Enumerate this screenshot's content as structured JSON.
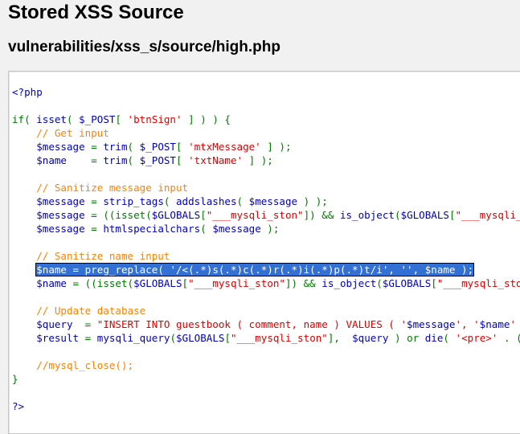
{
  "page": {
    "title": "Stored XSS Source",
    "file_path": "vulnerabilities/xss_s/source/high.php"
  },
  "colors": {
    "keyword": "#007700",
    "variable": "#0000bb",
    "string": "#dd0000",
    "comment": "#ff8000",
    "selection": "#3370d4"
  },
  "code": {
    "selected_line": 13,
    "lines": [
      [
        [
          "var",
          "<?php"
        ]
      ],
      [],
      [
        [
          "keyword",
          "if( "
        ],
        [
          "var",
          "isset"
        ],
        [
          "keyword",
          "( "
        ],
        [
          "var",
          "$_POST"
        ],
        [
          "keyword",
          "[ "
        ],
        [
          "string",
          "'btnSign'"
        ],
        [
          "keyword",
          " ] ) ) {"
        ]
      ],
      [
        [
          "plain",
          "    "
        ],
        [
          "comment",
          "// Get input"
        ]
      ],
      [
        [
          "plain",
          "    "
        ],
        [
          "var",
          "$message"
        ],
        [
          "keyword",
          " = "
        ],
        [
          "var",
          "trim"
        ],
        [
          "keyword",
          "( "
        ],
        [
          "var",
          "$_POST"
        ],
        [
          "keyword",
          "[ "
        ],
        [
          "string",
          "'mtxMessage'"
        ],
        [
          "keyword",
          " ] );"
        ]
      ],
      [
        [
          "plain",
          "    "
        ],
        [
          "var",
          "$name"
        ],
        [
          "keyword",
          "    = "
        ],
        [
          "var",
          "trim"
        ],
        [
          "keyword",
          "( "
        ],
        [
          "var",
          "$_POST"
        ],
        [
          "keyword",
          "[ "
        ],
        [
          "string",
          "'txtName'"
        ],
        [
          "keyword",
          " ] );"
        ]
      ],
      [],
      [
        [
          "plain",
          "    "
        ],
        [
          "comment",
          "// Sanitize message input"
        ]
      ],
      [
        [
          "plain",
          "    "
        ],
        [
          "var",
          "$message"
        ],
        [
          "keyword",
          " = "
        ],
        [
          "var",
          "strip_tags"
        ],
        [
          "keyword",
          "( "
        ],
        [
          "var",
          "addslashes"
        ],
        [
          "keyword",
          "( "
        ],
        [
          "var",
          "$message"
        ],
        [
          "keyword",
          " ) );"
        ]
      ],
      [
        [
          "plain",
          "    "
        ],
        [
          "var",
          "$message"
        ],
        [
          "keyword",
          " = ((isset("
        ],
        [
          "var",
          "$GLOBALS"
        ],
        [
          "keyword",
          "["
        ],
        [
          "string",
          "\"___mysqli_ston\""
        ],
        [
          "keyword",
          "]) && "
        ],
        [
          "var",
          "is_object"
        ],
        [
          "keyword",
          "("
        ],
        [
          "var",
          "$GLOBALS"
        ],
        [
          "keyword",
          "["
        ],
        [
          "string",
          "\"___mysqli_ston\""
        ],
        [
          "keyword",
          "])) ?"
        ]
      ],
      [
        [
          "plain",
          "    "
        ],
        [
          "var",
          "$message"
        ],
        [
          "keyword",
          " = "
        ],
        [
          "var",
          "htmlspecialchars"
        ],
        [
          "keyword",
          "( "
        ],
        [
          "var",
          "$message"
        ],
        [
          "keyword",
          " );"
        ]
      ],
      [],
      [
        [
          "plain",
          "    "
        ],
        [
          "comment",
          "// Sanitize name input"
        ]
      ],
      [
        [
          "plain",
          "    "
        ],
        [
          "var",
          "$name"
        ],
        [
          "keyword",
          " = "
        ],
        [
          "var",
          "preg_replace"
        ],
        [
          "keyword",
          "( "
        ],
        [
          "string",
          "'/<(.*)s(.*)c(.*)r(.*)i(.*)p(.*)t/i'"
        ],
        [
          "keyword",
          ", "
        ],
        [
          "string",
          "''"
        ],
        [
          "keyword",
          ", "
        ],
        [
          "var",
          "$name"
        ],
        [
          "keyword",
          " );"
        ]
      ],
      [
        [
          "plain",
          "    "
        ],
        [
          "var",
          "$name"
        ],
        [
          "keyword",
          " = ((isset("
        ],
        [
          "var",
          "$GLOBALS"
        ],
        [
          "keyword",
          "["
        ],
        [
          "string",
          "\"___mysqli_ston\""
        ],
        [
          "keyword",
          "]) && "
        ],
        [
          "var",
          "is_object"
        ],
        [
          "keyword",
          "("
        ],
        [
          "var",
          "$GLOBALS"
        ],
        [
          "keyword",
          "["
        ],
        [
          "string",
          "\"___mysqli_ston\""
        ],
        [
          "keyword",
          "])) ?"
        ]
      ],
      [],
      [
        [
          "plain",
          "    "
        ],
        [
          "comment",
          "// Update database"
        ]
      ],
      [
        [
          "plain",
          "    "
        ],
        [
          "var",
          "$query"
        ],
        [
          "keyword",
          "  = "
        ],
        [
          "string",
          "\"INSERT INTO guestbook ( comment, name ) VALUES ( '"
        ],
        [
          "var",
          "$message"
        ],
        [
          "string",
          "', '"
        ],
        [
          "var",
          "$name"
        ],
        [
          "string",
          "' );\""
        ],
        [
          "keyword",
          ";"
        ]
      ],
      [
        [
          "plain",
          "    "
        ],
        [
          "var",
          "$result"
        ],
        [
          "keyword",
          " = "
        ],
        [
          "var",
          "mysqli_query"
        ],
        [
          "keyword",
          "("
        ],
        [
          "var",
          "$GLOBALS"
        ],
        [
          "keyword",
          "["
        ],
        [
          "string",
          "\"___mysqli_ston\""
        ],
        [
          "keyword",
          "],  "
        ],
        [
          "var",
          "$query"
        ],
        [
          "keyword",
          " ) or "
        ],
        [
          "var",
          "die"
        ],
        [
          "keyword",
          "( "
        ],
        [
          "string",
          "'<pre>'"
        ],
        [
          "keyword",
          " . ((is_object("
        ]
      ],
      [],
      [
        [
          "plain",
          "    "
        ],
        [
          "comment",
          "//mysql_close();"
        ]
      ],
      [
        [
          "keyword",
          "}"
        ]
      ],
      [],
      [
        [
          "var",
          "?>"
        ]
      ]
    ]
  }
}
